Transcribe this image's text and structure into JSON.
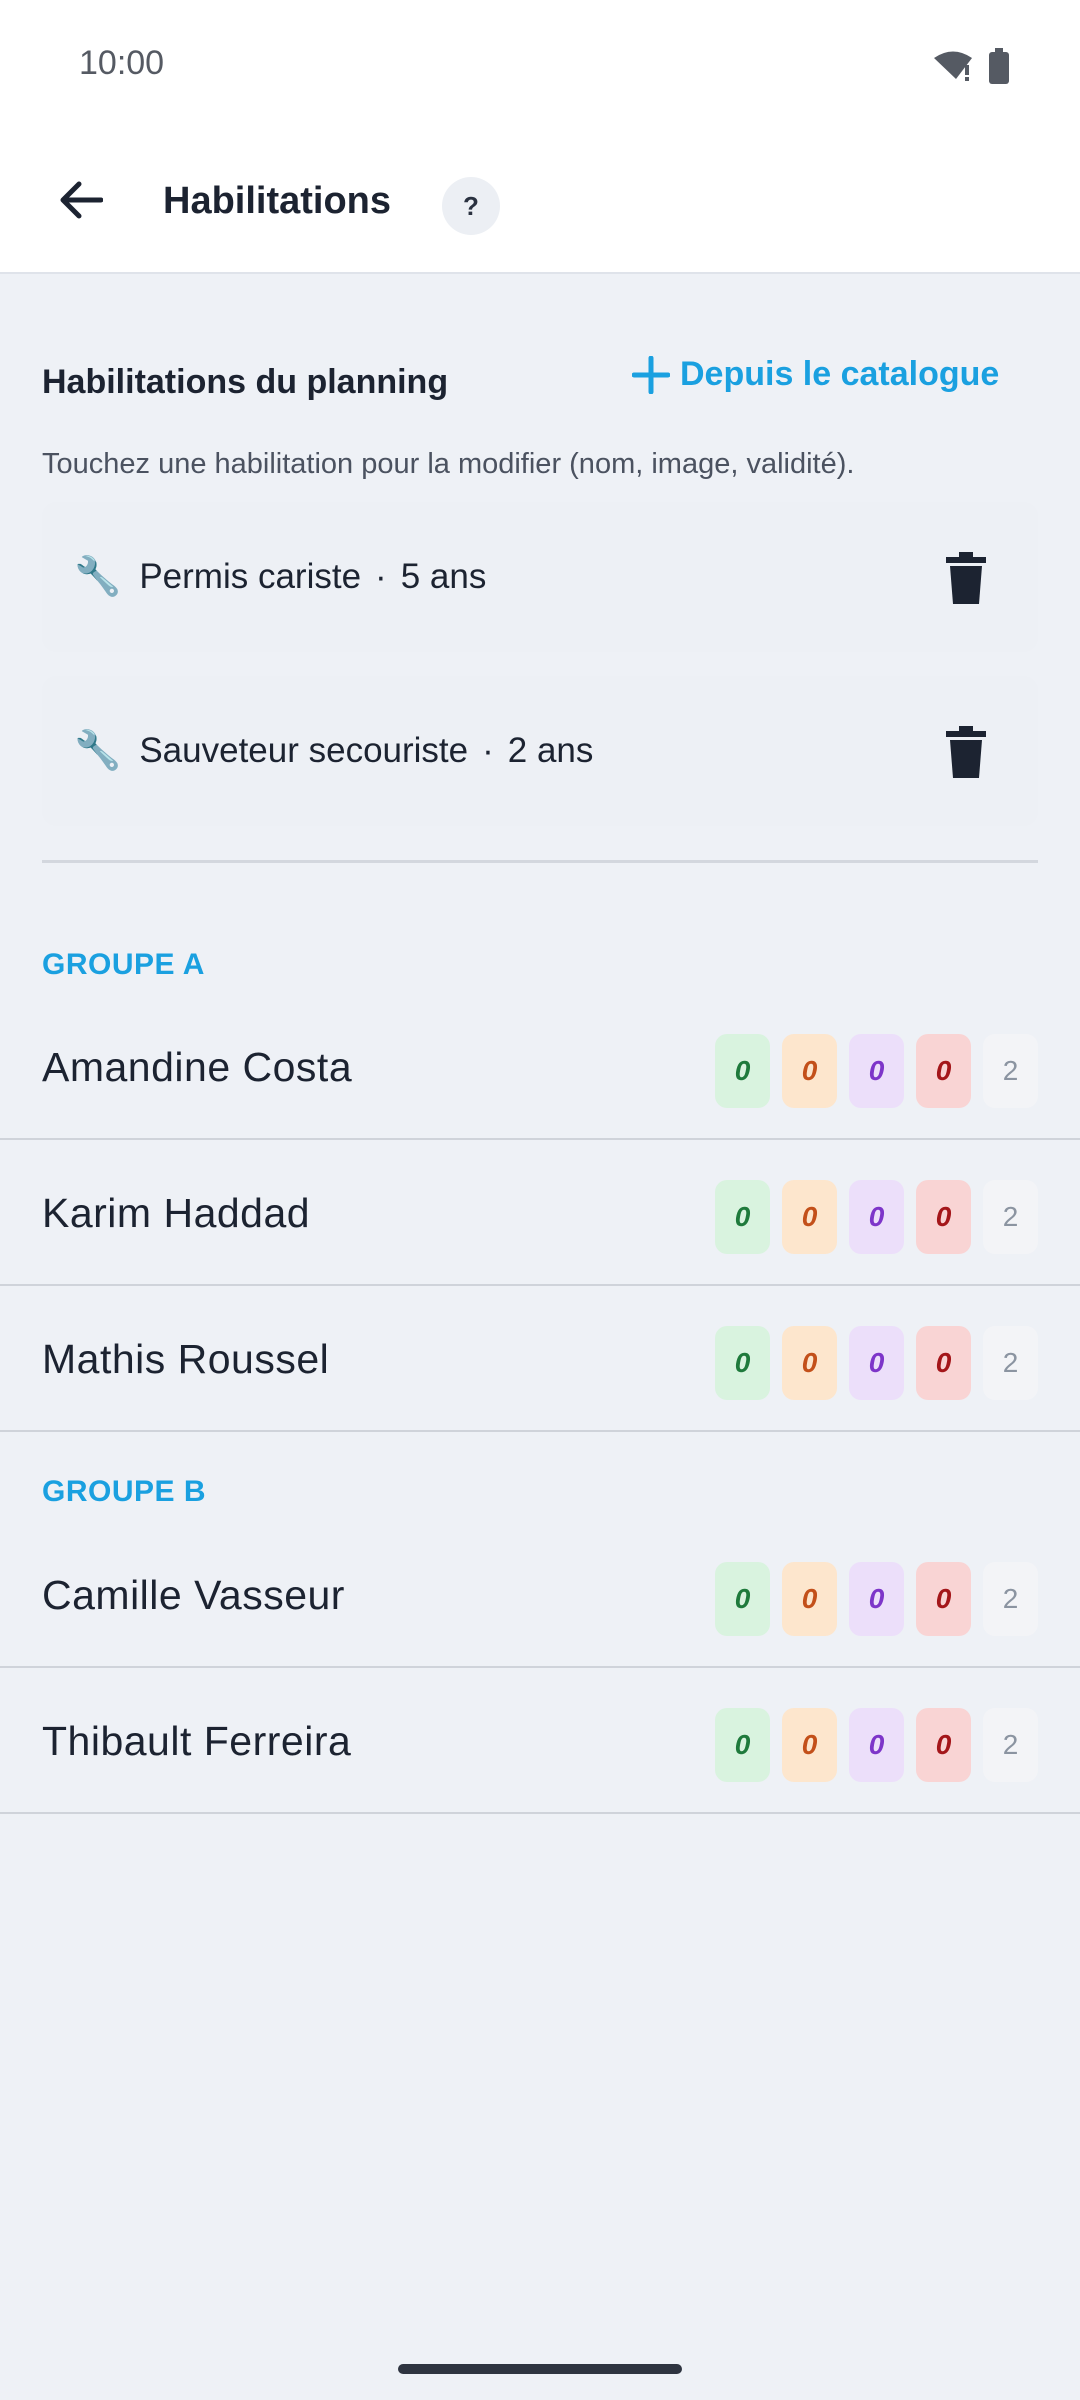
{
  "status": {
    "time": "10:00"
  },
  "header": {
    "title": "Habilitations",
    "help": "?"
  },
  "section": {
    "title": "Habilitations du planning",
    "catalog_label": "Depuis le catalogue",
    "hint": "Touchez une habilitation pour la modifier (nom, image, validité)."
  },
  "habilitations": [
    {
      "name": "Permis cariste",
      "sep": "·",
      "duration": "5 ans"
    },
    {
      "name": "Sauveteur secouriste",
      "sep": "·",
      "duration": "2 ans"
    }
  ],
  "groups": [
    {
      "label": "GROUPE A",
      "members": [
        {
          "name": "Amandine Costa",
          "badges": [
            "0",
            "0",
            "0",
            "0",
            "2"
          ]
        },
        {
          "name": "Karim Haddad",
          "badges": [
            "0",
            "0",
            "0",
            "0",
            "2"
          ]
        },
        {
          "name": "Mathis Roussel",
          "badges": [
            "0",
            "0",
            "0",
            "0",
            "2"
          ]
        }
      ]
    },
    {
      "label": "GROUPE B",
      "members": [
        {
          "name": "Camille Vasseur",
          "badges": [
            "0",
            "0",
            "0",
            "0",
            "2"
          ]
        },
        {
          "name": "Thibault Ferreira",
          "badges": [
            "0",
            "0",
            "0",
            "0",
            "2"
          ]
        }
      ]
    }
  ],
  "colors": {
    "accent": "#1aa0e0",
    "badge_green": "#1f7a3c",
    "badge_orange": "#c3501a",
    "badge_purple": "#7d35c9",
    "badge_red": "#a4161a"
  },
  "icons": {
    "back": "arrow-left-icon",
    "add": "plus-icon",
    "wrench": "wrench-icon",
    "delete": "trash-icon"
  }
}
